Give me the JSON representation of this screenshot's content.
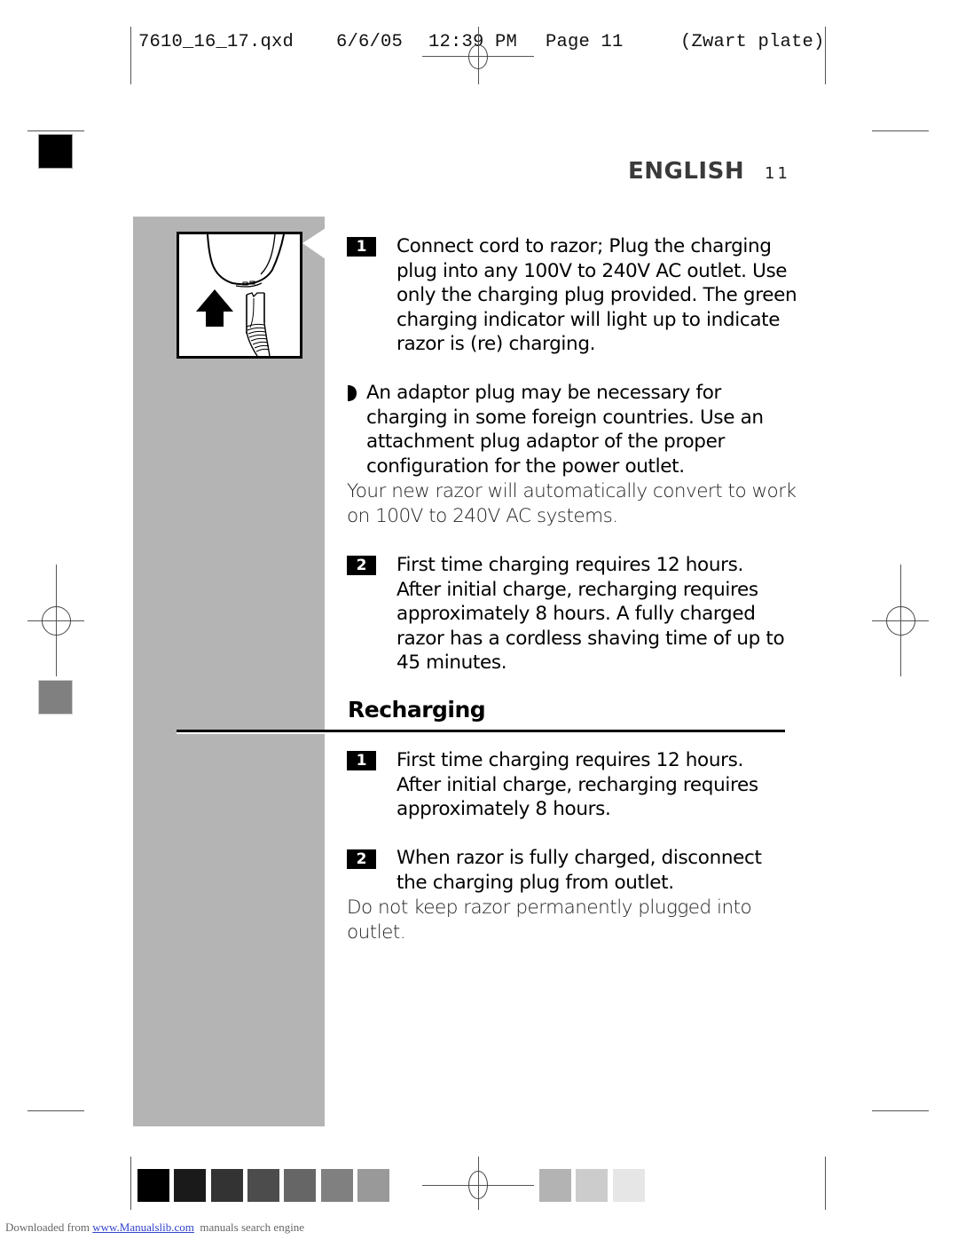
{
  "slug": {
    "filename": "7610_16_17.qxd",
    "date": "6/6/05",
    "time": "12:39 PM",
    "page": "Page 11",
    "plate": "(Zwart plate)"
  },
  "header": {
    "language": "ENGLISH",
    "page_number": "11"
  },
  "section_charging": {
    "steps": [
      {
        "number": "1",
        "lines": [
          "Connect cord to razor; Plug the charging",
          "plug into any 100V to 240V AC outlet. Use",
          "only the charging plug provided. The green",
          "charging indicator will light up to indicate",
          "razor is (re) charging."
        ]
      },
      {
        "number": "2",
        "lines": [
          "First time charging requires 12 hours.",
          "After initial charge, recharging requires",
          "approximately 8 hours.  A fully charged",
          "razor has a cordless shaving time of up to",
          "45 minutes."
        ]
      }
    ],
    "bullet": {
      "icon": "half-circle-bullet-icon",
      "lines": [
        "An adaptor plug may be necessary for",
        "charging in some foreign countries.  Use an",
        "attachment plug adaptor of the proper",
        "configuration for the power outlet."
      ]
    },
    "note_lines": [
      "Your new razor will automatically convert to work",
      "on 100V to 240V AC systems."
    ]
  },
  "section_recharging": {
    "title": "Recharging",
    "steps": [
      {
        "number": "1",
        "lines": [
          "First time charging requires 12 hours.",
          "After initial charge, recharging requires",
          "approximately 8 hours."
        ]
      },
      {
        "number": "2",
        "lines": [
          "When razor is fully charged, disconnect",
          "the charging plug from outlet."
        ]
      }
    ],
    "note_lines": [
      "Do not keep razor permanently plugged into",
      "outlet."
    ]
  },
  "illustration": {
    "icon": "razor-plug-illustration",
    "arrow_icon": "arrow-up-icon"
  },
  "color_bar": {
    "dark_swatches": [
      "#000000",
      "#1a1a1a",
      "#333333",
      "#4c4c4c",
      "#666666",
      "#808080",
      "#999999"
    ],
    "light_swatches": [
      "#b3b3b3",
      "#cccccc",
      "#e6e6e6"
    ]
  },
  "side_marks": {
    "top_square_color": "#000000",
    "mid_square_color": "#808080",
    "band_color": "#b4b4b4"
  },
  "footer": {
    "prefix": "Downloaded from ",
    "link": "www.Manualslib.com",
    "suffix": "  manuals search engine"
  }
}
